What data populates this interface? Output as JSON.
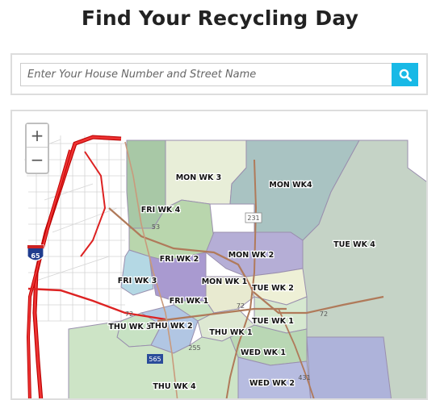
{
  "page": {
    "title": "Find Your Recycling Day"
  },
  "search": {
    "placeholder": "Enter Your House Number and Street Name"
  },
  "map": {
    "zoom_in": "+",
    "zoom_out": "−",
    "zones": [
      "MON WK 3",
      "MON WK4",
      "FRI WK 4",
      "TUE WK 4",
      "FRI WK 2",
      "MON WK 2",
      "FRI WK 3",
      "MON WK 1",
      "TUE WK 2",
      "FRI WK 1",
      "THU WK 3",
      "THU WK 2",
      "TUE WK 1",
      "THU WK 1",
      "WED WK 1",
      "WED WK 2",
      "THU WK 4"
    ],
    "route_shields": [
      "65",
      "53",
      "231",
      "72",
      "72",
      "565",
      "255",
      "431",
      "72"
    ]
  },
  "colors": {
    "search_button": "#18b9e6"
  }
}
